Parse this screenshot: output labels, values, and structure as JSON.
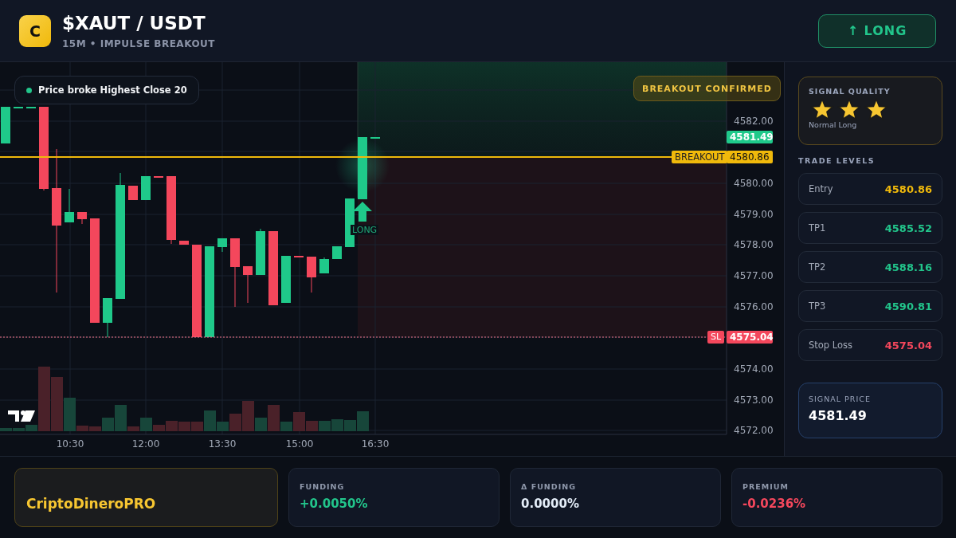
{
  "header": {
    "logo": "C",
    "title": "$XAUT / USDT",
    "subtitle": "15M • IMPULSE BREAKOUT",
    "direction_button": "↑ LONG"
  },
  "chart": {
    "signal_note": "Price broke Highest Close 20",
    "badge": "BREAKOUT CONFIRMED",
    "y_ticks": [
      "4582.00",
      "4580.00",
      "4579.00",
      "4578.00",
      "4577.00",
      "4576.00",
      "4574.00",
      "4573.00",
      "4572.00"
    ],
    "x_ticks": [
      "10:30",
      "12:00",
      "13:30",
      "15:00",
      "16:30"
    ],
    "price_tag": "4581.49",
    "breakout_tag": {
      "label": "BREAKOUT",
      "value": "4580.86"
    },
    "stop_tag": {
      "label": "SL",
      "value": "4575.04"
    },
    "marker_label": "LONG"
  },
  "signal_quality": {
    "title": "SIGNAL QUALITY",
    "stars": 3,
    "label": "Normal Long"
  },
  "trade_levels": {
    "title": "TRADE LEVELS",
    "rows": [
      {
        "label": "Entry",
        "value": "4580.86",
        "kind": "entry"
      },
      {
        "label": "TP1",
        "value": "4585.52",
        "kind": "target"
      },
      {
        "label": "TP2",
        "value": "4588.16",
        "kind": "target"
      },
      {
        "label": "TP3",
        "value": "4590.81",
        "kind": "target"
      },
      {
        "label": "Stop Loss",
        "value": "4575.04",
        "kind": "stop"
      }
    ]
  },
  "signal_price": {
    "label": "SIGNAL PRICE",
    "value": "4581.49"
  },
  "footer": {
    "brand": "CriptoDineroPRO",
    "metrics": [
      {
        "label": "FUNDING",
        "value": "+0.0050%",
        "kind": "positive"
      },
      {
        "label": "Δ FUNDING",
        "value": "0.0000%",
        "kind": "neutral"
      },
      {
        "label": "PREMIUM",
        "value": "-0.0236%",
        "kind": "negative"
      }
    ]
  }
}
